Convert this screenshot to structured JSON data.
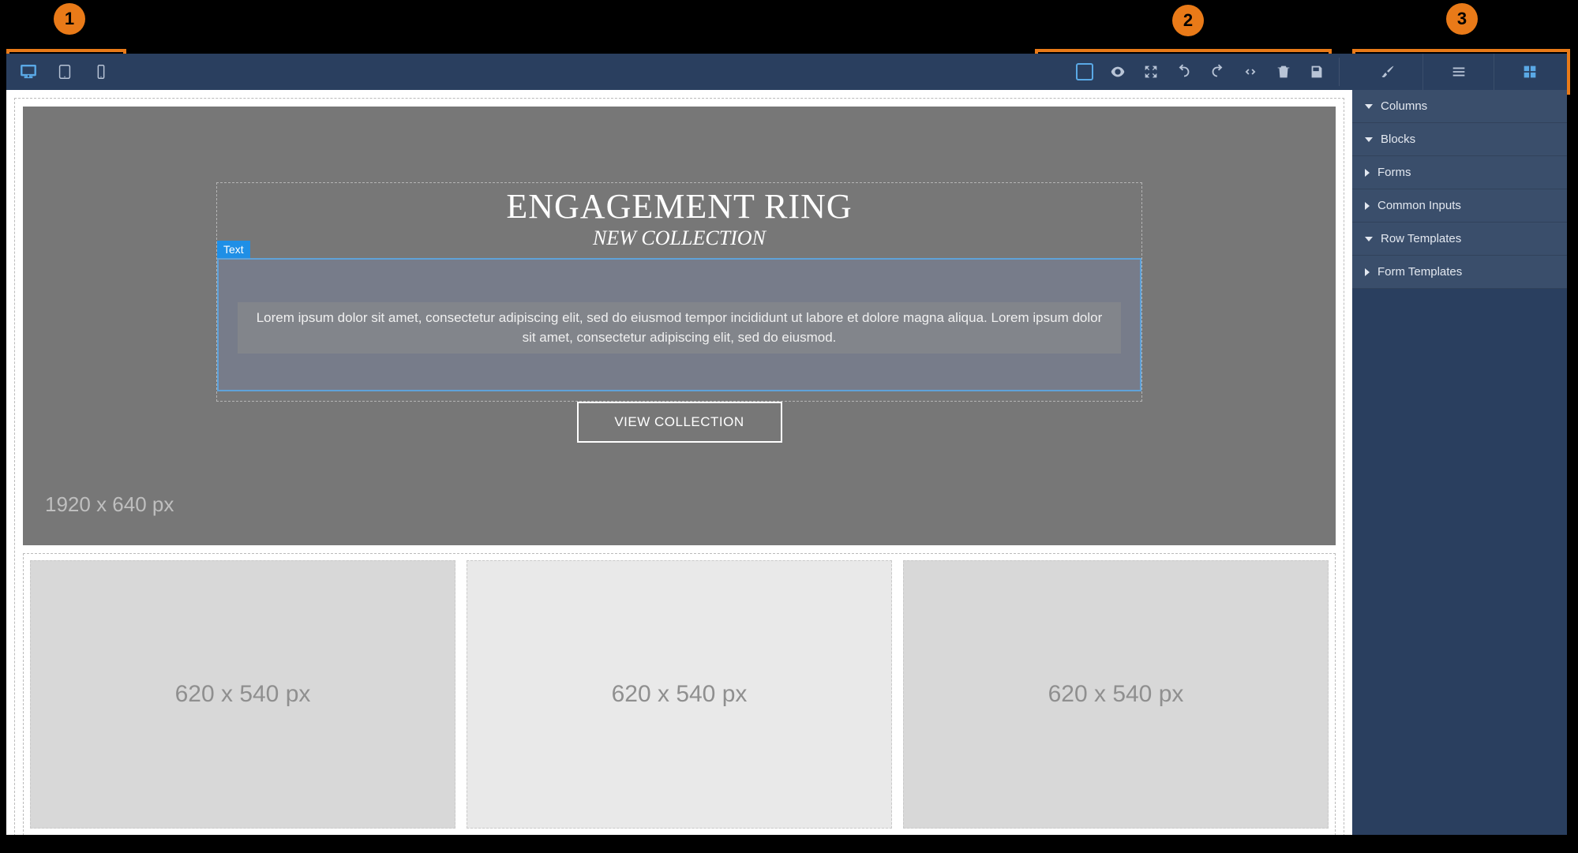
{
  "annotations": {
    "marker1": "1",
    "marker2": "2",
    "marker3": "3"
  },
  "toolbar": {
    "device": {
      "desktop_name": "desktop-icon",
      "tablet_name": "tablet-icon",
      "mobile_name": "mobile-icon"
    },
    "actions": {
      "outline_name": "outline-icon",
      "preview_name": "eye-icon",
      "fullscreen_name": "fullscreen-icon",
      "undo_name": "undo-icon",
      "redo_name": "redo-icon",
      "code_name": "code-icon",
      "trash_name": "trash-icon",
      "save_name": "save-icon"
    }
  },
  "sidebar": {
    "tabs": {
      "style_name": "brush-icon",
      "layers_name": "menu-icon",
      "blocks_name": "grid-icon"
    },
    "panels": [
      {
        "label": "Columns",
        "expanded": true
      },
      {
        "label": "Blocks",
        "expanded": true
      },
      {
        "label": "Forms",
        "expanded": false
      },
      {
        "label": "Common Inputs",
        "expanded": false
      },
      {
        "label": "Row Templates",
        "expanded": true
      },
      {
        "label": "Form Templates",
        "expanded": false
      }
    ]
  },
  "hero": {
    "title": "ENGAGEMENT RING",
    "subtitle": "NEW COLLECTION",
    "text_tag": "Text",
    "body": "Lorem ipsum dolor sit amet, consectetur adipiscing elit, sed do eiusmod tempor incididunt ut labore et dolore magna aliqua. Lorem ipsum dolor sit amet, consectetur adipiscing elit, sed do eiusmod.",
    "cta_label": "VIEW COLLECTION",
    "dimension_label": "1920 x 640 px"
  },
  "cards": {
    "label": "620 x 540 px"
  }
}
